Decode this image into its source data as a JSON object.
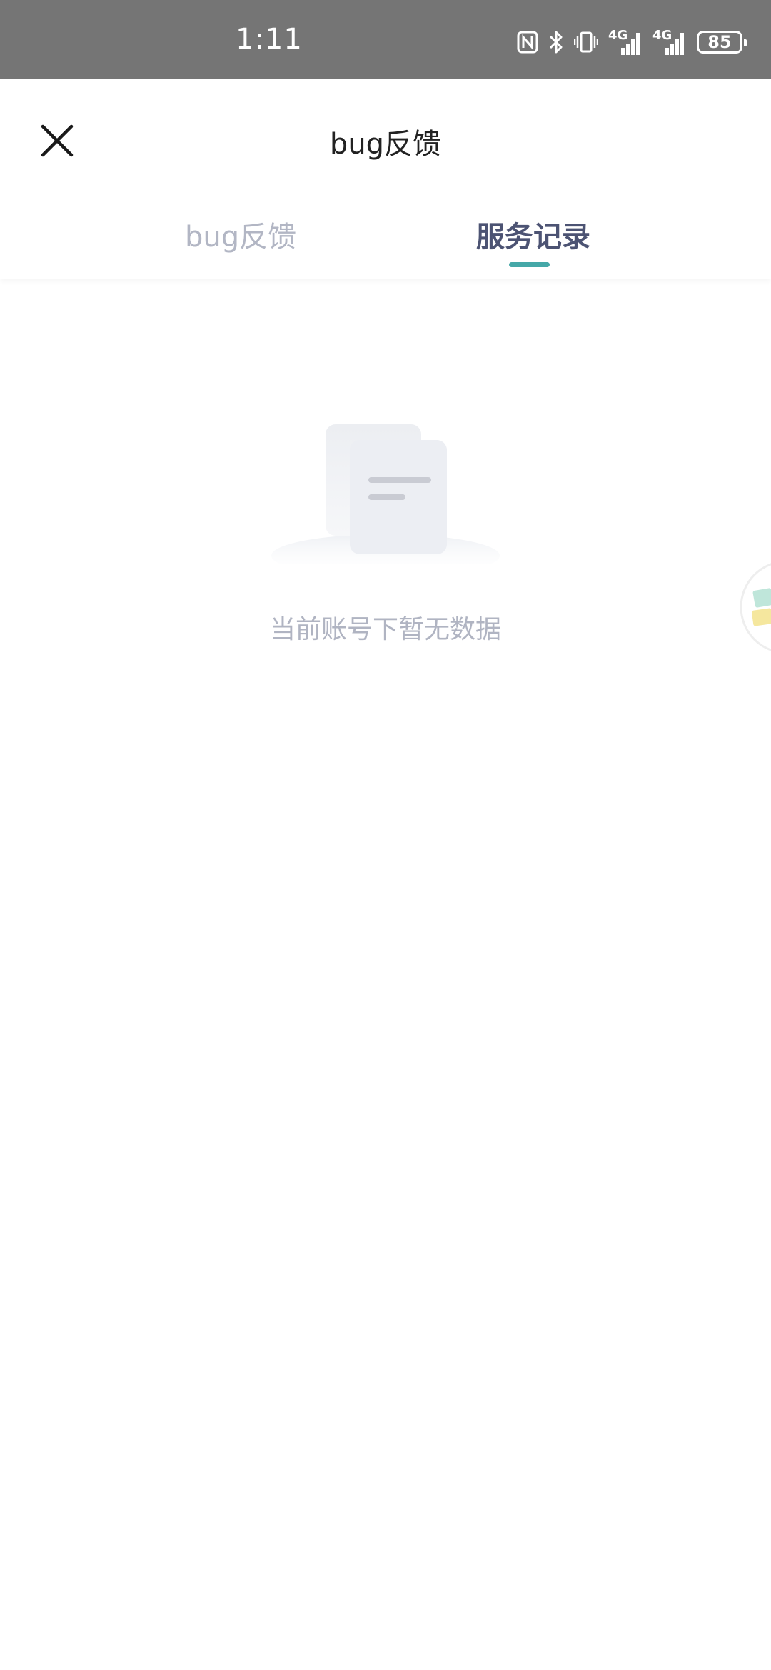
{
  "status_bar": {
    "time": "1:11",
    "network_1": "4G",
    "network_2": "4G",
    "battery": "85"
  },
  "nav": {
    "title": "bug反馈",
    "close_icon": "close-icon"
  },
  "tabs": [
    {
      "label": "bug反馈",
      "active": false
    },
    {
      "label": "服务记录",
      "active": true
    }
  ],
  "empty_state": {
    "message": "当前账号下暂无数据",
    "icon": "empty-document-icon"
  },
  "colors": {
    "status_bar_bg": "#757575",
    "tab_active": "#4c5373",
    "tab_inactive": "#b2b6c4",
    "tab_indicator": "#45a8a8",
    "empty_text": "#b0b4c2"
  }
}
